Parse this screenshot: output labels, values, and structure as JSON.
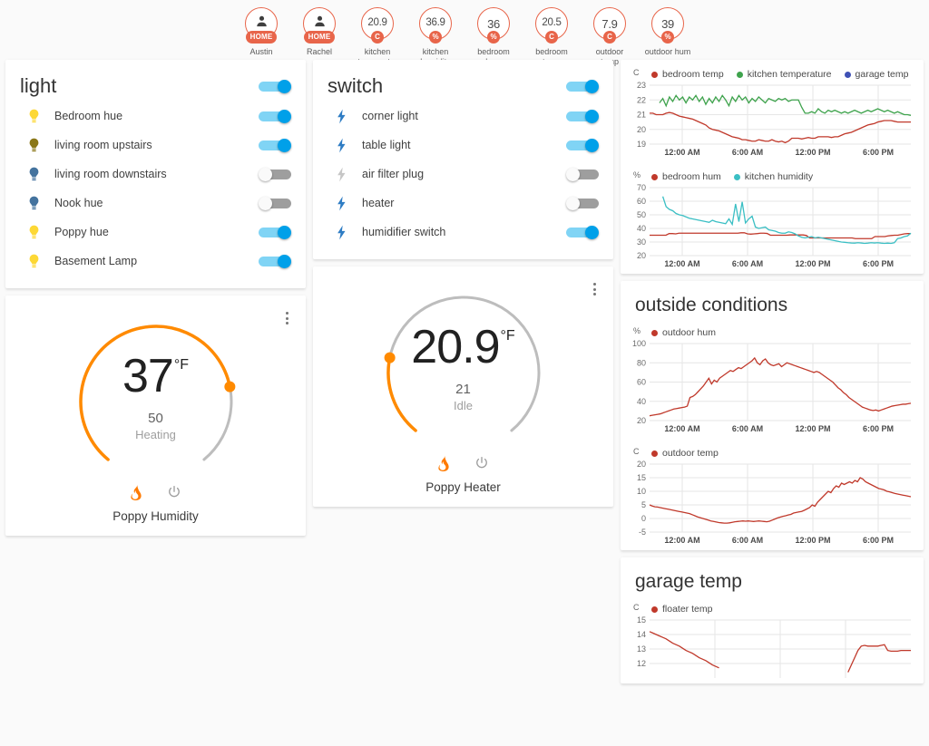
{
  "badges": [
    {
      "type": "person",
      "icon": "person-icon",
      "value": "",
      "unit": "HOME",
      "unit_style": "pill",
      "label": "Austin"
    },
    {
      "type": "person",
      "icon": "person-icon",
      "value": "",
      "unit": "HOME",
      "unit_style": "pill",
      "label": "Rachel"
    },
    {
      "type": "sensor",
      "value": "20.9",
      "unit": "C",
      "unit_style": "round",
      "label": "kitchen temperat..."
    },
    {
      "type": "sensor",
      "value": "36.9",
      "unit": "%",
      "unit_style": "round",
      "label": "kitchen humidity"
    },
    {
      "type": "sensor",
      "value": "36",
      "unit": "%",
      "unit_style": "round",
      "label": "bedroom hum"
    },
    {
      "type": "sensor",
      "value": "20.5",
      "unit": "C",
      "unit_style": "round",
      "label": "bedroom temp"
    },
    {
      "type": "sensor",
      "value": "7.9",
      "unit": "C",
      "unit_style": "round",
      "label": "outdoor temp"
    },
    {
      "type": "sensor",
      "value": "39",
      "unit": "%",
      "unit_style": "round",
      "label": "outdoor hum"
    }
  ],
  "light_card": {
    "title": "light",
    "master_toggle": "on",
    "entities": [
      {
        "name": "Bedroom hue",
        "icon": "lightbulb-icon",
        "icon_color": "#FDD835",
        "toggle": "on"
      },
      {
        "name": "living room upstairs",
        "icon": "lightbulb-icon",
        "icon_color": "#8A7718",
        "toggle": "on"
      },
      {
        "name": "living room downstairs",
        "icon": "lightbulb-icon",
        "icon_color": "#44739E",
        "toggle": "off"
      },
      {
        "name": "Nook hue",
        "icon": "lightbulb-icon",
        "icon_color": "#44739E",
        "toggle": "off"
      },
      {
        "name": "Poppy hue",
        "icon": "lightbulb-icon",
        "icon_color": "#FDD835",
        "toggle": "on"
      },
      {
        "name": "Basement Lamp",
        "icon": "lightbulb-icon",
        "icon_color": "#FDD835",
        "toggle": "on"
      }
    ]
  },
  "switch_card": {
    "title": "switch",
    "master_toggle": "on",
    "entities": [
      {
        "name": "corner light",
        "icon": "flash-icon",
        "icon_color": "#2E7CC4",
        "toggle": "on"
      },
      {
        "name": "table light",
        "icon": "flash-icon",
        "icon_color": "#2E7CC4",
        "toggle": "on"
      },
      {
        "name": "air filter plug",
        "icon": "flash-icon",
        "icon_color": "#C6C6C6",
        "toggle": "off"
      },
      {
        "name": "heater",
        "icon": "flash-icon",
        "icon_color": "#2E7CC4",
        "toggle": "off"
      },
      {
        "name": "humidifier switch",
        "icon": "flash-icon",
        "icon_color": "#2E7CC4",
        "toggle": "on"
      }
    ]
  },
  "thermostat_humidity": {
    "name": "Poppy Humidity",
    "current": "37",
    "unit": "°F",
    "target": "50",
    "state": "Heating",
    "arc_fraction": 0.78,
    "arc_color": "#FF8A00",
    "modes": [
      {
        "icon": "flame-icon",
        "active": true
      },
      {
        "icon": "power-icon",
        "active": false
      }
    ]
  },
  "thermostat_heater": {
    "name": "Poppy Heater",
    "current": "20.9",
    "unit": "°F",
    "target": "21",
    "state": "Idle",
    "arc_fraction": 0.22,
    "arc_color": "#FF8A00",
    "modes": [
      {
        "icon": "flame-icon",
        "active": true
      },
      {
        "icon": "power-icon",
        "active": false
      }
    ]
  },
  "outside_card": {
    "title": "outside conditions"
  },
  "garage_card": {
    "title": "garage temp"
  },
  "chart_data": [
    {
      "id": "indoor_temp",
      "type": "line",
      "title": "",
      "ylabel": "C",
      "ylim": [
        19,
        23
      ],
      "yticks": [
        19,
        20,
        21,
        22,
        23
      ],
      "xticks": [
        "12:00 AM",
        "6:00 AM",
        "12:00 PM",
        "6:00 PM"
      ],
      "grid": true,
      "legend_position": "top",
      "series": [
        {
          "name": "bedroom temp",
          "color": "#C0392B",
          "values": [
            21.1,
            21.1,
            21.0,
            21.0,
            21.0,
            21.1,
            21.15,
            21.1,
            21.0,
            20.9,
            20.85,
            20.8,
            20.75,
            20.7,
            20.6,
            20.5,
            20.4,
            20.3,
            20.1,
            20.0,
            19.95,
            19.9,
            19.8,
            19.7,
            19.6,
            19.5,
            19.45,
            19.4,
            19.3,
            19.3,
            19.25,
            19.2,
            19.2,
            19.3,
            19.25,
            19.2,
            19.2,
            19.3,
            19.2,
            19.15,
            19.2,
            19.1,
            19.2,
            19.4,
            19.4,
            19.4,
            19.35,
            19.4,
            19.45,
            19.4,
            19.4,
            19.5,
            19.5,
            19.5,
            19.5,
            19.45,
            19.5,
            19.5,
            19.6,
            19.7,
            19.75,
            19.8,
            19.9,
            20.0,
            20.1,
            20.2,
            20.3,
            20.35,
            20.4,
            20.5,
            20.55,
            20.6,
            20.6,
            20.6,
            20.55,
            20.5,
            20.5,
            20.5,
            20.5,
            20.5
          ]
        },
        {
          "name": "kitchen temperature",
          "color": "#3FA34D",
          "values": [
            null,
            null,
            null,
            21.8,
            22.1,
            21.6,
            22.2,
            21.9,
            22.3,
            22.0,
            22.2,
            21.8,
            22.2,
            22.0,
            22.3,
            21.9,
            22.2,
            21.7,
            22.1,
            21.8,
            22.2,
            21.9,
            22.3,
            22.0,
            21.6,
            22.2,
            21.9,
            22.3,
            22.0,
            22.2,
            21.8,
            22.1,
            21.9,
            22.2,
            22.0,
            21.8,
            22.1,
            22.0,
            21.9,
            22.1,
            22.0,
            22.1,
            21.9,
            22.0,
            22.0,
            22.0,
            21.5,
            21.1,
            21.1,
            21.2,
            21.1,
            21.4,
            21.2,
            21.1,
            21.3,
            21.2,
            21.3,
            21.2,
            21.1,
            21.2,
            21.1,
            21.2,
            21.3,
            21.2,
            21.1,
            21.2,
            21.3,
            21.2,
            21.3,
            21.4,
            21.3,
            21.2,
            21.3,
            21.2,
            21.1,
            21.2,
            21.1,
            21.0,
            21.0,
            20.95
          ]
        },
        {
          "name": "garage temp",
          "color": "#3F51B5",
          "values": []
        }
      ]
    },
    {
      "id": "indoor_hum",
      "type": "line",
      "title": "",
      "ylabel": "%",
      "ylim": [
        20,
        70
      ],
      "yticks": [
        20,
        30,
        40,
        50,
        60,
        70
      ],
      "xticks": [
        "12:00 AM",
        "6:00 AM",
        "12:00 PM",
        "6:00 PM"
      ],
      "grid": true,
      "legend_position": "top",
      "series": [
        {
          "name": "bedroom hum",
          "color": "#C0392B",
          "values": [
            35,
            35,
            35,
            35,
            35,
            35,
            36.2,
            36.2,
            36,
            36.5,
            36.5,
            36.5,
            36.5,
            36.5,
            36.5,
            36.5,
            36.5,
            36.5,
            36.5,
            36.5,
            36.5,
            36.5,
            36.5,
            36.5,
            36.5,
            36.5,
            36.5,
            36.5,
            36.8,
            36.8,
            36,
            35.8,
            36,
            36.2,
            36.5,
            36.5,
            36.3,
            35,
            35,
            35,
            35,
            35,
            35,
            35.2,
            35.2,
            35.2,
            35.2,
            35.2,
            34.8,
            33,
            33,
            33,
            33,
            33,
            33,
            33,
            33,
            33,
            33,
            33,
            33,
            33,
            33,
            32.5,
            32.5,
            32.5,
            32.5,
            32.5,
            32.5,
            34,
            34,
            34,
            34,
            34.5,
            34.8,
            35,
            35,
            35.5,
            36,
            36.2,
            36.2
          ]
        },
        {
          "name": "kitchen humidity",
          "color": "#3BBFC4",
          "values": [
            null,
            null,
            null,
            null,
            63.5,
            56,
            54,
            53,
            51,
            50,
            49.5,
            48.5,
            47.5,
            47,
            46.5,
            46,
            45.5,
            45,
            44.5,
            46,
            45,
            44.5,
            44,
            43.5,
            47,
            43,
            58,
            45,
            59.5,
            44,
            47,
            49,
            41,
            40,
            40.5,
            41,
            39,
            38.5,
            38,
            37,
            36.5,
            36.5,
            37.5,
            37,
            36,
            34.5,
            33.5,
            33,
            33.5,
            34,
            33,
            33.5,
            33,
            32.5,
            32,
            31.5,
            31,
            30.5,
            30,
            29.8,
            29.5,
            29.3,
            29.2,
            29.5,
            29.3,
            29,
            29.2,
            29.5,
            29.3,
            29.5,
            29.2,
            29,
            29.2,
            29,
            29.5,
            32.5,
            33,
            34,
            34.5,
            36.5
          ]
        }
      ]
    },
    {
      "id": "outdoor_hum",
      "type": "line",
      "title": "",
      "ylabel": "%",
      "ylim": [
        20,
        100
      ],
      "yticks": [
        20,
        40,
        60,
        80,
        100
      ],
      "xticks": [
        "12:00 AM",
        "6:00 AM",
        "12:00 PM",
        "6:00 PM"
      ],
      "grid": true,
      "legend_position": "top",
      "series": [
        {
          "name": "outdoor hum",
          "color": "#C0392B",
          "values": [
            25,
            25.5,
            26,
            26.5,
            27,
            28,
            29,
            30,
            31,
            32,
            32.5,
            33,
            33.5,
            34,
            35,
            44,
            45,
            47,
            50,
            53,
            56,
            60,
            64,
            58,
            62,
            60,
            64,
            66,
            68,
            70,
            72,
            71,
            73,
            75,
            74,
            76,
            78,
            80,
            82,
            85,
            80,
            78,
            82,
            84,
            80,
            78,
            77,
            78,
            79,
            76,
            78,
            80,
            79,
            78,
            77,
            76,
            75,
            74,
            73,
            72,
            71,
            70,
            71,
            70,
            68,
            66,
            64,
            62,
            60,
            57,
            54,
            52,
            49,
            47,
            44,
            42,
            40,
            38,
            36,
            34,
            33,
            32,
            31,
            30.5,
            31,
            30,
            31,
            32,
            33,
            34,
            35,
            35.5,
            36,
            36.5,
            37,
            37,
            37.5,
            38
          ]
        }
      ]
    },
    {
      "id": "outdoor_temp",
      "type": "line",
      "title": "",
      "ylabel": "C",
      "ylim": [
        -5,
        20
      ],
      "yticks": [
        -5,
        0,
        5,
        10,
        15,
        20
      ],
      "xticks": [
        "12:00 AM",
        "6:00 AM",
        "12:00 PM",
        "6:00 PM"
      ],
      "grid": true,
      "legend_position": "top",
      "series": [
        {
          "name": "outdoor temp",
          "color": "#C0392B",
          "values": [
            5,
            4.6,
            4.3,
            4.2,
            4,
            3.8,
            3.6,
            3.4,
            3.2,
            3,
            2.8,
            2.6,
            2.4,
            2.2,
            2,
            1.8,
            1.4,
            1,
            0.6,
            0.3,
            0,
            -0.3,
            -0.6,
            -0.9,
            -1.1,
            -1.3,
            -1.5,
            -1.6,
            -1.7,
            -1.7,
            -1.6,
            -1.4,
            -1.2,
            -1.1,
            -1,
            -0.9,
            -1,
            -0.9,
            -1,
            -1.1,
            -1,
            -0.9,
            -1,
            -1.1,
            -1.2,
            -1,
            -0.6,
            -0.2,
            0.2,
            0.5,
            0.8,
            1,
            1.3,
            1.5,
            2,
            2.2,
            2.4,
            2.6,
            3,
            3.5,
            4,
            5,
            4.5,
            6,
            7,
            8,
            9,
            10,
            9.5,
            11,
            12,
            11.5,
            13,
            12.5,
            13,
            13.5,
            13,
            14,
            13.5,
            15,
            14.5,
            13.5,
            13,
            12.5,
            12,
            11.5,
            11,
            10.8,
            10.5,
            10,
            9.8,
            9.5,
            9.2,
            9,
            8.8,
            8.6,
            8.4,
            8.2,
            8
          ]
        }
      ]
    },
    {
      "id": "garage_temp",
      "type": "line",
      "title": "",
      "ylabel": "C",
      "ylim": [
        11,
        15
      ],
      "yticks": [
        12,
        13,
        14,
        15
      ],
      "xticks": [],
      "grid": true,
      "legend_position": "top",
      "series": [
        {
          "name": "floater temp",
          "color": "#C0392B",
          "values": [
            14.2,
            14.1,
            14.0,
            13.9,
            13.8,
            13.7,
            13.55,
            13.4,
            13.3,
            13.2,
            13.05,
            12.9,
            12.8,
            12.7,
            12.55,
            12.4,
            12.3,
            12.2,
            12.05,
            11.9,
            11.8,
            11.7,
            null,
            null,
            null,
            null,
            null,
            null,
            null,
            null,
            null,
            null,
            null,
            null,
            null,
            null,
            null,
            null,
            null,
            null,
            null,
            null,
            null,
            null,
            null,
            null,
            null,
            null,
            null,
            null,
            null,
            null,
            null,
            null,
            null,
            null,
            null,
            null,
            null,
            null,
            11.4,
            11.9,
            12.4,
            12.9,
            13.2,
            13.25,
            13.2,
            13.2,
            13.2,
            13.2,
            13.25,
            13.3,
            12.9,
            12.85,
            12.85,
            12.85,
            12.9,
            12.9,
            12.9,
            12.9
          ]
        }
      ]
    }
  ]
}
